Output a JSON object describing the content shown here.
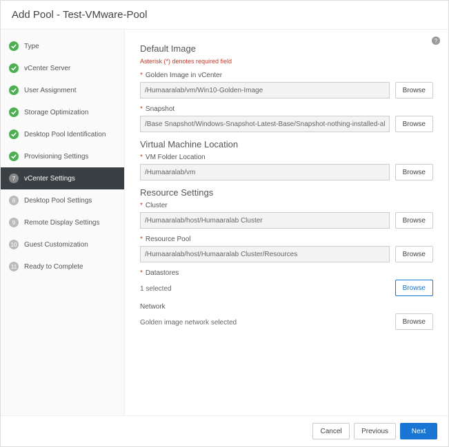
{
  "header": {
    "title": "Add Pool - Test-VMware-Pool"
  },
  "steps": [
    {
      "label": "Type",
      "state": "done"
    },
    {
      "label": "vCenter Server",
      "state": "done"
    },
    {
      "label": "User Assignment",
      "state": "done"
    },
    {
      "label": "Storage Optimization",
      "state": "done"
    },
    {
      "label": "Desktop Pool Identification",
      "state": "done"
    },
    {
      "label": "Provisioning Settings",
      "state": "done"
    },
    {
      "label": "vCenter Settings",
      "state": "current",
      "num": "7"
    },
    {
      "label": "Desktop Pool Settings",
      "state": "pending",
      "num": "8"
    },
    {
      "label": "Remote Display Settings",
      "state": "pending",
      "num": "9"
    },
    {
      "label": "Guest Customization",
      "state": "pending",
      "num": "10"
    },
    {
      "label": "Ready to Complete",
      "state": "pending",
      "num": "11"
    }
  ],
  "sections": {
    "defaultImage": {
      "title": "Default Image",
      "requiredNote": "Asterisk (*) denotes required field",
      "golden": {
        "label": "Golden Image in vCenter",
        "value": "/Humaaralab/vm/Win10-Golden-Image",
        "browse": "Browse"
      },
      "snapshot": {
        "label": "Snapshot",
        "value": "/Base Snapshot/Windows-Snapshot-Latest-Base/Snapshot-nothing-installed-all-",
        "browse": "Browse"
      }
    },
    "vmLocation": {
      "title": "Virtual Machine Location",
      "folder": {
        "label": "VM Folder Location",
        "value": "/Humaaralab/vm",
        "browse": "Browse"
      }
    },
    "resource": {
      "title": "Resource Settings",
      "cluster": {
        "label": "Cluster",
        "value": "/Humaaralab/host/Humaaralab Cluster",
        "browse": "Browse"
      },
      "pool": {
        "label": "Resource Pool",
        "value": "/Humaaralab/host/Humaaralab Cluster/Resources",
        "browse": "Browse"
      },
      "datastores": {
        "label": "Datastores",
        "value": "1 selected",
        "browse": "Browse"
      },
      "network": {
        "label": "Network",
        "value": "Golden image network selected",
        "browse": "Browse"
      }
    }
  },
  "footer": {
    "cancel": "Cancel",
    "previous": "Previous",
    "next": "Next"
  }
}
